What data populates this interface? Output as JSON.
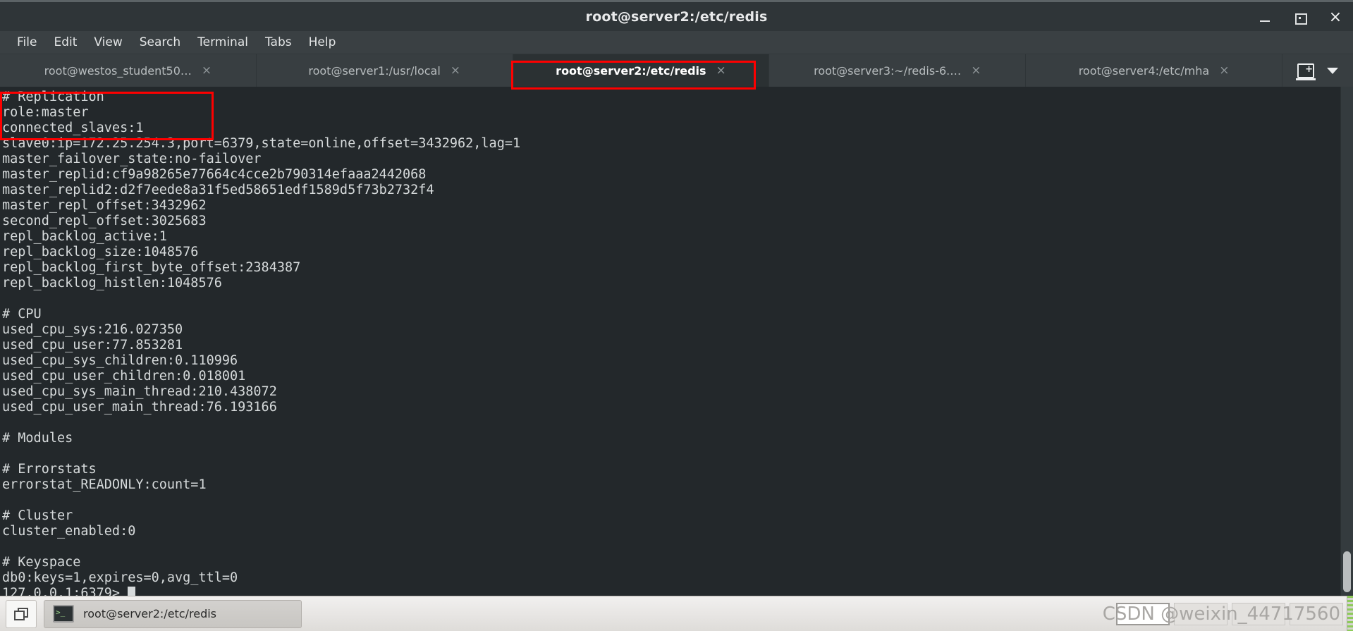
{
  "window": {
    "title": "root@server2:/etc/redis",
    "controls": {
      "minimize": "minimize-button",
      "maximize": "maximize-button",
      "close": "×"
    }
  },
  "menubar": {
    "items": [
      {
        "label": "File"
      },
      {
        "label": "Edit"
      },
      {
        "label": "View"
      },
      {
        "label": "Search"
      },
      {
        "label": "Terminal"
      },
      {
        "label": "Tabs"
      },
      {
        "label": "Help"
      }
    ]
  },
  "tabbar": {
    "tabs": [
      {
        "label": "root@westos_student50…",
        "close": "×",
        "active": false
      },
      {
        "label": "root@server1:/usr/local",
        "close": "×",
        "active": false
      },
      {
        "label": "root@server2:/etc/redis",
        "close": "×",
        "active": true
      },
      {
        "label": "root@server3:~/redis-6.…",
        "close": "×",
        "active": false
      },
      {
        "label": "root@server4:/etc/mha",
        "close": "×",
        "active": false
      }
    ],
    "new_tab_icon": "new-terminal-tab-icon",
    "dropdown_icon": "chevron-down-icon"
  },
  "terminal": {
    "lines": [
      "# Replication",
      "role:master",
      "connected_slaves:1",
      "slave0:ip=172.25.254.3,port=6379,state=online,offset=3432962,lag=1",
      "master_failover_state:no-failover",
      "master_replid:cf9a98265e77664c4cce2b790314efaaa2442068",
      "master_replid2:d2f7eede8a31f5ed58651edf1589d5f73b2732f4",
      "master_repl_offset:3432962",
      "second_repl_offset:3025683",
      "repl_backlog_active:1",
      "repl_backlog_size:1048576",
      "repl_backlog_first_byte_offset:2384387",
      "repl_backlog_histlen:1048576",
      "",
      "# CPU",
      "used_cpu_sys:216.027350",
      "used_cpu_user:77.853281",
      "used_cpu_sys_children:0.110996",
      "used_cpu_user_children:0.018001",
      "used_cpu_sys_main_thread:210.438072",
      "used_cpu_user_main_thread:76.193166",
      "",
      "# Modules",
      "",
      "# Errorstats",
      "errorstat_READONLY:count=1",
      "",
      "# Cluster",
      "cluster_enabled:0",
      "",
      "# Keyspace",
      "db0:keys=1,expires=0,avg_ttl=0"
    ],
    "prompt": "127.0.0.1:6379> ",
    "background_color": "#23282b",
    "text_color": "#d6dadb"
  },
  "annotations": {
    "color": "#fe0000",
    "boxes": [
      {
        "name": "active-tab-highlight"
      },
      {
        "name": "replication-info-highlight"
      }
    ]
  },
  "taskbar": {
    "show_desktop_icon": "window-switcher-icon",
    "window_button": {
      "icon": "terminal-icon",
      "label": "root@server2:/etc/redis"
    },
    "watermark": "CSDN @weixin_44717560"
  }
}
